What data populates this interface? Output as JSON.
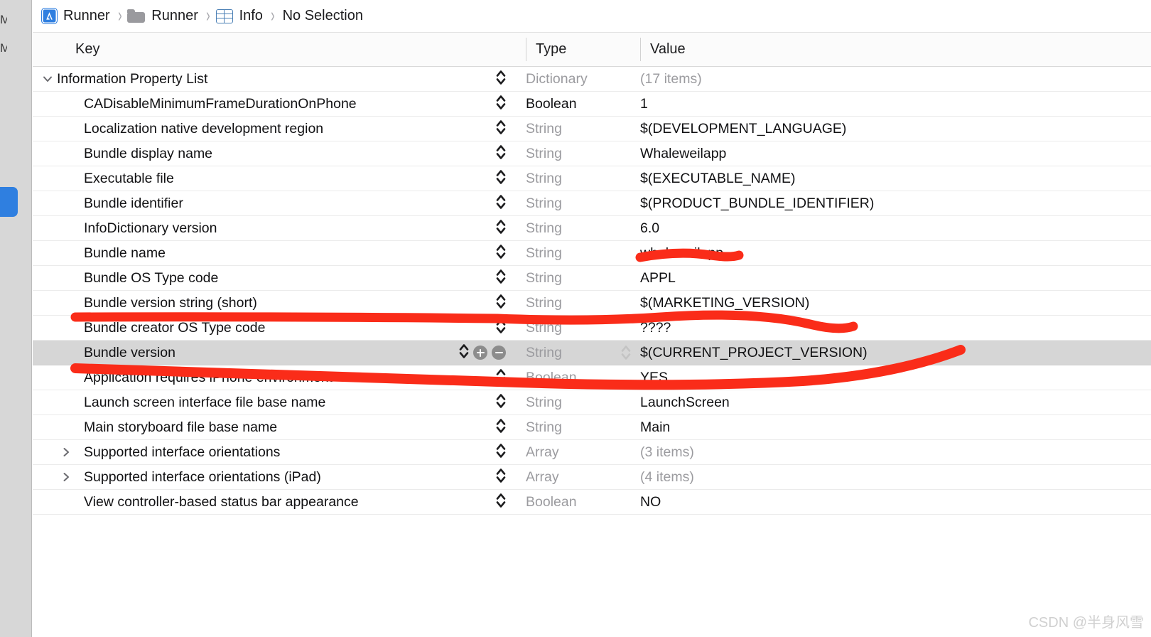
{
  "window": {
    "title": "Xcode Info.plist editor"
  },
  "navigator": {
    "clipped_items": [
      "M",
      "M"
    ],
    "selected_color": "#2f7fe0"
  },
  "breadcrumb": {
    "items": [
      {
        "icon": "xcode-app-icon",
        "label": "Runner"
      },
      {
        "icon": "folder-icon",
        "label": "Runner"
      },
      {
        "icon": "plist-table-icon",
        "label": "Info"
      },
      {
        "icon": "none",
        "label": "No Selection"
      }
    ],
    "separator": "›"
  },
  "table": {
    "columns": [
      "Key",
      "Type",
      "Value"
    ],
    "rows": [
      {
        "key": "Information Property List",
        "type": "Dictionary",
        "value": "(17 items)",
        "level": 0,
        "disclosure": "expanded",
        "type_dim": true,
        "value_dim": true,
        "selected": false
      },
      {
        "key": "CADisableMinimumFrameDurationOnPhone",
        "type": "Boolean",
        "value": "1",
        "level": 1,
        "disclosure": "none",
        "type_dim": false,
        "value_dim": false,
        "selected": false
      },
      {
        "key": "Localization native development region",
        "type": "String",
        "value": "$(DEVELOPMENT_LANGUAGE)",
        "level": 1,
        "disclosure": "none",
        "type_dim": true,
        "value_dim": false,
        "selected": false
      },
      {
        "key": "Bundle display name",
        "type": "String",
        "value": "Whaleweilapp",
        "level": 1,
        "disclosure": "none",
        "type_dim": true,
        "value_dim": false,
        "selected": false
      },
      {
        "key": "Executable file",
        "type": "String",
        "value": "$(EXECUTABLE_NAME)",
        "level": 1,
        "disclosure": "none",
        "type_dim": true,
        "value_dim": false,
        "selected": false
      },
      {
        "key": "Bundle identifier",
        "type": "String",
        "value": "$(PRODUCT_BUNDLE_IDENTIFIER)",
        "level": 1,
        "disclosure": "none",
        "type_dim": true,
        "value_dim": false,
        "selected": false
      },
      {
        "key": "InfoDictionary version",
        "type": "String",
        "value": "6.0",
        "level": 1,
        "disclosure": "none",
        "type_dim": true,
        "value_dim": false,
        "selected": false
      },
      {
        "key": "Bundle name",
        "type": "String",
        "value": "whaleweilapp",
        "level": 1,
        "disclosure": "none",
        "type_dim": true,
        "value_dim": false,
        "selected": false
      },
      {
        "key": "Bundle OS Type code",
        "type": "String",
        "value": "APPL",
        "level": 1,
        "disclosure": "none",
        "type_dim": true,
        "value_dim": false,
        "selected": false
      },
      {
        "key": "Bundle version string (short)",
        "type": "String",
        "value": "$(MARKETING_VERSION)",
        "level": 1,
        "disclosure": "none",
        "type_dim": true,
        "value_dim": false,
        "selected": false
      },
      {
        "key": "Bundle creator OS Type code",
        "type": "String",
        "value": "????",
        "level": 1,
        "disclosure": "none",
        "type_dim": true,
        "value_dim": false,
        "selected": false
      },
      {
        "key": "Bundle version",
        "type": "String",
        "value": "$(CURRENT_PROJECT_VERSION)",
        "level": 1,
        "disclosure": "none",
        "type_dim": true,
        "value_dim": false,
        "selected": true
      },
      {
        "key": "Application requires iPhone environment",
        "type": "Boolean",
        "value": "YES",
        "level": 1,
        "disclosure": "none",
        "type_dim": true,
        "value_dim": false,
        "selected": false
      },
      {
        "key": "Launch screen interface file base name",
        "type": "String",
        "value": "LaunchScreen",
        "level": 1,
        "disclosure": "none",
        "type_dim": true,
        "value_dim": false,
        "selected": false
      },
      {
        "key": "Main storyboard file base name",
        "type": "String",
        "value": "Main",
        "level": 1,
        "disclosure": "none",
        "type_dim": true,
        "value_dim": false,
        "selected": false
      },
      {
        "key": "Supported interface orientations",
        "type": "Array",
        "value": "(3 items)",
        "level": 1,
        "disclosure": "collapsed",
        "type_dim": true,
        "value_dim": true,
        "selected": false
      },
      {
        "key": "Supported interface orientations (iPad)",
        "type": "Array",
        "value": "(4 items)",
        "level": 1,
        "disclosure": "collapsed",
        "type_dim": true,
        "value_dim": true,
        "selected": false
      },
      {
        "key": "View controller-based status bar appearance",
        "type": "Boolean",
        "value": "NO",
        "level": 1,
        "disclosure": "none",
        "type_dim": true,
        "value_dim": false,
        "selected": false
      }
    ],
    "selected_row_controls": {
      "stepper": "stepper-icon",
      "add": "+",
      "remove": "−"
    }
  },
  "annotations": {
    "color": "#fa2c19",
    "marks": [
      "strike-bundle-name-value",
      "underline-bundle-version-string-short",
      "underline-bundle-version-row"
    ]
  },
  "watermark": {
    "text": "CSDN @半身风雪"
  }
}
